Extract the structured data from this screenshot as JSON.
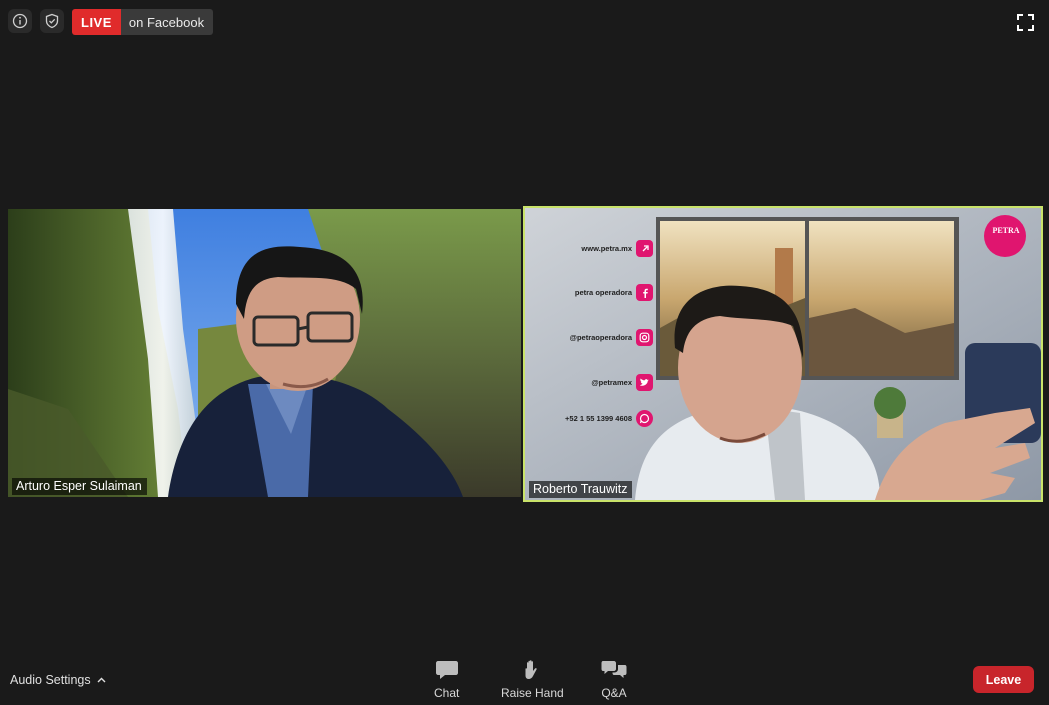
{
  "top_bar": {
    "live_badge": "LIVE",
    "live_destination": "on Facebook",
    "info_icon": "info-icon",
    "security_icon": "shield-icon",
    "fullscreen_icon": "fullscreen-icon"
  },
  "participants": [
    {
      "name": "Arturo Esper Sulaiman",
      "active_speaker": false
    },
    {
      "name": "Roberto Trauwitz",
      "active_speaker": true
    }
  ],
  "virtual_background_text": {
    "lines": [
      "www.petra.mx",
      "petra operadora",
      "@petraoperadora",
      "@petramex",
      "+52 1 55 1399 4608"
    ],
    "logo": "PETRA"
  },
  "toolbar": {
    "audio_settings": "Audio Settings",
    "chat": "Chat",
    "raise_hand": "Raise Hand",
    "qa": "Q&A",
    "leave": "Leave"
  },
  "colors": {
    "background": "#1a1a1a",
    "live_red": "#e02b2b",
    "active_speaker_border": "#c9e36a",
    "leave_red": "#c8252b",
    "brand_pink": "#e0156f"
  }
}
